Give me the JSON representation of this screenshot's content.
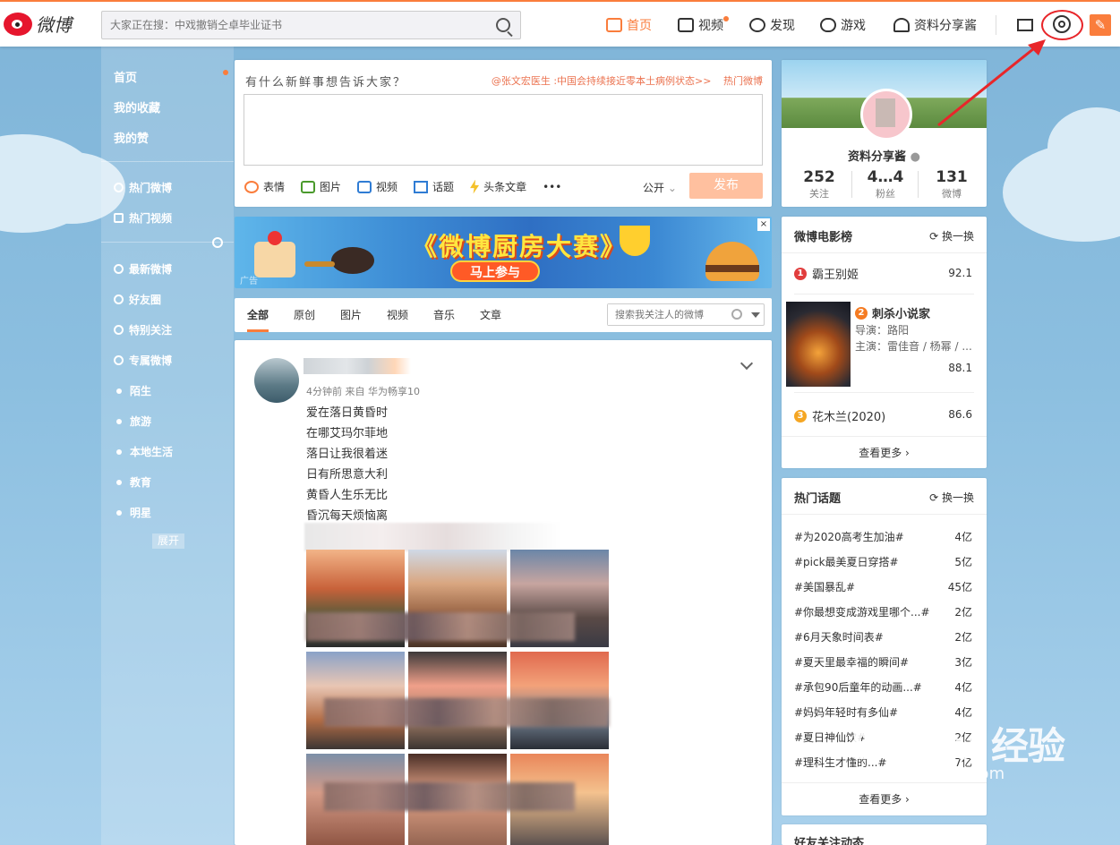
{
  "header": {
    "logo_text": "微博",
    "search_placeholder": "大家正在搜：中戏撤销仝卓毕业证书",
    "nav": [
      {
        "label": "首页",
        "icon": "home-icon",
        "active": true
      },
      {
        "label": "视频",
        "icon": "video-icon"
      },
      {
        "label": "发现",
        "icon": "compass-icon"
      },
      {
        "label": "游戏",
        "icon": "gamepad-icon"
      },
      {
        "label": "资料分享酱",
        "icon": "user-icon"
      }
    ],
    "accent_color": "#fa7d3c"
  },
  "left_nav": {
    "primary": [
      "首页",
      "我的收藏",
      "我的赞"
    ],
    "secondary": [
      "热门微博",
      "热门视频"
    ],
    "groups": [
      "最新微博",
      "好友圈",
      "特别关注",
      "专属微博"
    ],
    "bullets": [
      "陌生",
      "旅游",
      "本地生活",
      "教育",
      "明星"
    ],
    "expand_label": "展开"
  },
  "composer": {
    "title": "有什么新鲜事想告诉大家？",
    "hot_link": "@张文宏医生 :中国会持续接近零本土病例状态>>",
    "hot_weibo": "热门微博",
    "tools": [
      "表情",
      "图片",
      "视频",
      "话题",
      "头条文章",
      "•••"
    ],
    "visibility": "公开",
    "send_label": "发布"
  },
  "banner": {
    "title": "《微博厨房大赛》",
    "button": "马上参与",
    "ad_label": "广告",
    "close": "×"
  },
  "feed_tabs": {
    "items": [
      "全部",
      "原创",
      "图片",
      "视频",
      "音乐",
      "文章"
    ],
    "search_placeholder": "搜索我关注人的微博"
  },
  "post": {
    "meta": "4分钟前 来自 华为畅享10",
    "lines": [
      "爱在落日黄昏时",
      "在哪艾玛尔菲地",
      "落日让我很着迷",
      "日有所思意大利",
      "黄昏人生乐无比",
      "昏沉每天烦恼离"
    ]
  },
  "profile": {
    "name": "资料分享酱",
    "stats": [
      {
        "value": "252",
        "label": "关注"
      },
      {
        "value": "4…4",
        "label": "粉丝"
      },
      {
        "value": "131",
        "label": "微博"
      }
    ]
  },
  "movies": {
    "title": "微博电影榜",
    "refresh": "换一换",
    "items": [
      {
        "rank": "1",
        "name": "霸王别姬",
        "score": "92.1",
        "color": "#e13d3d"
      },
      {
        "rank": "2",
        "name": "刺杀小说家",
        "director": "导演：路阳",
        "cast": "主演：雷佳音 / 杨幂 / ...",
        "score": "88.1",
        "color": "#f57b22"
      },
      {
        "rank": "3",
        "name": "花木兰(2020)",
        "score": "86.6",
        "color": "#f5a623"
      }
    ],
    "more": "查看更多 ›"
  },
  "topics": {
    "title": "热门话题",
    "refresh": "换一换",
    "items": [
      {
        "name": "#为2020高考生加油#",
        "count": "4亿"
      },
      {
        "name": "#pick最美夏日穿搭#",
        "count": "5亿"
      },
      {
        "name": "#美国暴乱#",
        "count": "45亿"
      },
      {
        "name": "#你最想变成游戏里哪个...#",
        "count": "2亿"
      },
      {
        "name": "#6月天象时间表#",
        "count": "2亿"
      },
      {
        "name": "#夏天里最幸福的瞬间#",
        "count": "3亿"
      },
      {
        "name": "#承包90后童年的动画...#",
        "count": "4亿"
      },
      {
        "name": "#妈妈年轻时有多仙#",
        "count": "4亿"
      },
      {
        "name": "#夏日神仙饮#",
        "count": "2亿"
      },
      {
        "name": "#理科生才懂的...#",
        "count": "7亿"
      }
    ],
    "more": "查看更多 ›"
  },
  "friends_title": "好友关注动态",
  "watermark": {
    "brand": "Bai du 经验",
    "url": "jingyan.baidu.com"
  }
}
